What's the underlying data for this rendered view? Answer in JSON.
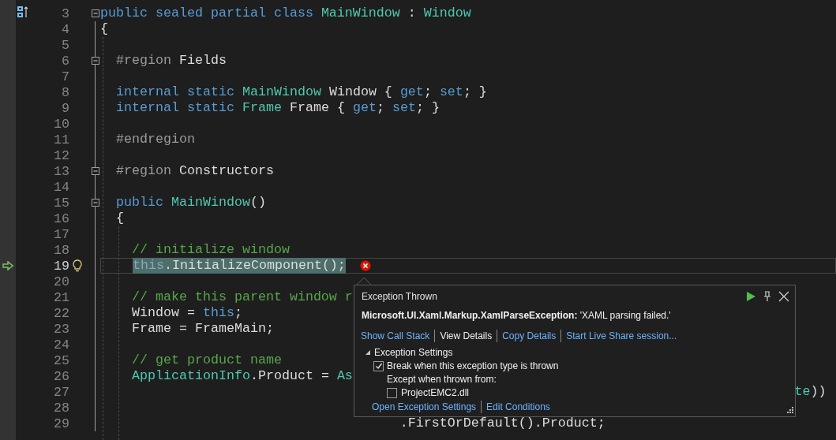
{
  "editor": {
    "lines": [
      {
        "number": "3",
        "current": false,
        "collapsible": true,
        "tokens": [
          {
            "kind": "keyword",
            "text": "public sealed partial class "
          },
          {
            "kind": "type",
            "text": "MainWindow"
          },
          {
            "kind": "plain",
            "text": " : "
          },
          {
            "kind": "type",
            "text": "Window"
          }
        ]
      },
      {
        "number": "4",
        "current": false,
        "collapsible": false,
        "tokens": [
          {
            "kind": "plain",
            "text": "{"
          }
        ]
      },
      {
        "number": "5",
        "current": false,
        "collapsible": false
      },
      {
        "number": "6",
        "current": false,
        "collapsible": true,
        "tokens": [
          {
            "kind": "preproc",
            "text": "  #region "
          },
          {
            "kind": "plain",
            "text": "Fields"
          }
        ]
      },
      {
        "number": "7",
        "current": false,
        "collapsible": false
      },
      {
        "number": "8",
        "current": false,
        "collapsible": false,
        "tokens": [
          {
            "kind": "keyword",
            "text": "  internal static "
          },
          {
            "kind": "type",
            "text": "MainWindow"
          },
          {
            "kind": "plain",
            "text": " Window { "
          },
          {
            "kind": "keyword",
            "text": "get"
          },
          {
            "kind": "plain",
            "text": "; "
          },
          {
            "kind": "keyword",
            "text": "set"
          },
          {
            "kind": "plain",
            "text": "; }"
          }
        ]
      },
      {
        "number": "9",
        "current": false,
        "collapsible": false,
        "tokens": [
          {
            "kind": "keyword",
            "text": "  internal static "
          },
          {
            "kind": "type",
            "text": "Frame"
          },
          {
            "kind": "plain",
            "text": " Frame { "
          },
          {
            "kind": "keyword",
            "text": "get"
          },
          {
            "kind": "plain",
            "text": "; "
          },
          {
            "kind": "keyword",
            "text": "set"
          },
          {
            "kind": "plain",
            "text": "; }"
          }
        ]
      },
      {
        "number": "10",
        "current": false,
        "collapsible": false
      },
      {
        "number": "11",
        "current": false,
        "collapsible": false,
        "tokens": [
          {
            "kind": "preproc",
            "text": "  #endregion"
          }
        ]
      },
      {
        "number": "12",
        "current": false,
        "collapsible": false
      },
      {
        "number": "13",
        "current": false,
        "collapsible": true,
        "tokens": [
          {
            "kind": "preproc",
            "text": "  #region "
          },
          {
            "kind": "plain",
            "text": "Constructors"
          }
        ]
      },
      {
        "number": "14",
        "current": false,
        "collapsible": false
      },
      {
        "number": "15",
        "current": false,
        "collapsible": true,
        "tokens": [
          {
            "kind": "keyword",
            "text": "  public "
          },
          {
            "kind": "type",
            "text": "MainWindow"
          },
          {
            "kind": "plain",
            "text": "()"
          }
        ]
      },
      {
        "number": "16",
        "current": false,
        "collapsible": false,
        "tokens": [
          {
            "kind": "plain",
            "text": "  {"
          }
        ]
      },
      {
        "number": "17",
        "current": false,
        "collapsible": false
      },
      {
        "number": "18",
        "current": false,
        "collapsible": false,
        "tokens": [
          {
            "kind": "comment",
            "text": "    // initialize window"
          }
        ]
      },
      {
        "number": "19",
        "current": true,
        "collapsible": false,
        "selection": true,
        "error": true,
        "tokens": [
          {
            "kind": "keyword",
            "text": "this"
          },
          {
            "kind": "plain",
            "text": ".InitializeComponent();"
          }
        ]
      },
      {
        "number": "20",
        "current": false,
        "collapsible": false
      },
      {
        "number": "21",
        "current": false,
        "collapsible": false,
        "tokens": [
          {
            "kind": "comment",
            "text": "    // make this parent window r"
          }
        ]
      },
      {
        "number": "22",
        "current": false,
        "collapsible": false,
        "tokens": [
          {
            "kind": "plain",
            "text": "    Window = "
          },
          {
            "kind": "keyword",
            "text": "this"
          },
          {
            "kind": "plain",
            "text": ";"
          }
        ]
      },
      {
        "number": "23",
        "current": false,
        "collapsible": false,
        "tokens": [
          {
            "kind": "plain",
            "text": "    Frame = FrameMain;"
          }
        ]
      },
      {
        "number": "24",
        "current": false,
        "collapsible": false
      },
      {
        "number": "25",
        "current": false,
        "collapsible": false,
        "tokens": [
          {
            "kind": "comment",
            "text": "    // get product name"
          }
        ]
      },
      {
        "number": "26",
        "current": false,
        "collapsible": false,
        "tokens": [
          {
            "kind": "type",
            "text": "    ApplicationInfo"
          },
          {
            "kind": "plain",
            "text": ".Product = "
          },
          {
            "kind": "type",
            "text": "As"
          }
        ]
      },
      {
        "number": "27",
        "current": false,
        "collapsible": false,
        "tokens": [
          {
            "kind": "type",
            "text": "                                                                                        te"
          },
          {
            "kind": "plain",
            "text": "))"
          }
        ]
      },
      {
        "number": "28",
        "current": false,
        "collapsible": false
      },
      {
        "number": "29",
        "current": false,
        "collapsible": false,
        "tokens": [
          {
            "kind": "plain",
            "text": "                                      .FirstOrDefault().Product;"
          }
        ]
      }
    ]
  },
  "exception_popup": {
    "title": "Exception Thrown",
    "exception_type": "Microsoft.UI.Xaml.Markup.XamlParseException:",
    "message": "'XAML parsing failed.'",
    "actions": [
      {
        "kind": "link",
        "text": "Show Call Stack"
      },
      {
        "kind": "command",
        "text": "View Details"
      },
      {
        "kind": "link",
        "text": "Copy Details"
      },
      {
        "kind": "link",
        "text": "Start Live Share session..."
      }
    ],
    "settings": {
      "title": "Exception Settings",
      "expanded": true,
      "break_option": {
        "label": "Break when this exception type is thrown",
        "checked": true
      },
      "except_label": "Except when thrown from:",
      "modules": [
        {
          "label": "ProjectEMC2.dll",
          "checked": false
        }
      ]
    },
    "footer_links": [
      "Open Exception Settings",
      "Edit Conditions"
    ]
  }
}
